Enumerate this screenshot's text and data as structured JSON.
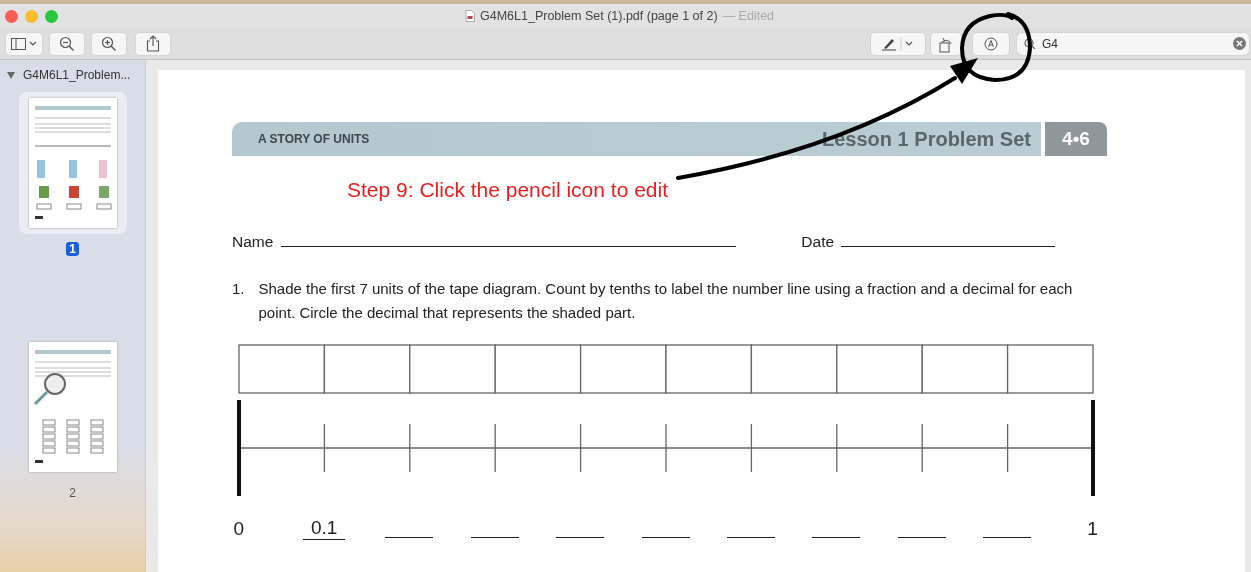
{
  "window": {
    "title": "G4M6L1_Problem Set (1).pdf (page 1 of 2)",
    "status": "— Edited"
  },
  "toolbar": {
    "search": {
      "value": "G4"
    }
  },
  "sidebar": {
    "header": "G4M6L1_Problem...",
    "expanded": true,
    "pages": [
      {
        "label": "1",
        "selected": true
      },
      {
        "label": "2",
        "selected": false
      }
    ]
  },
  "page": {
    "header_left": "A STORY OF UNITS",
    "header_title": "Lesson 1 Problem Set",
    "header_badge": "4•6",
    "annotation": "Step 9: Click the pencil icon to edit",
    "name_label": "Name",
    "date_label": "Date",
    "question_number": "1.",
    "question_text": "Shade the first 7 units of the tape diagram.  Count by tenths to label the number line using a fraction and a decimal for each point.  Circle the decimal that represents the shaded part.",
    "number_labels": [
      {
        "kind": "plain",
        "text": "0"
      },
      {
        "kind": "filled",
        "text": "0.1"
      },
      {
        "kind": "blank"
      },
      {
        "kind": "blank"
      },
      {
        "kind": "blank"
      },
      {
        "kind": "blank"
      },
      {
        "kind": "blank"
      },
      {
        "kind": "blank"
      },
      {
        "kind": "blank"
      },
      {
        "kind": "blank"
      },
      {
        "kind": "plain",
        "text": "1"
      }
    ]
  }
}
